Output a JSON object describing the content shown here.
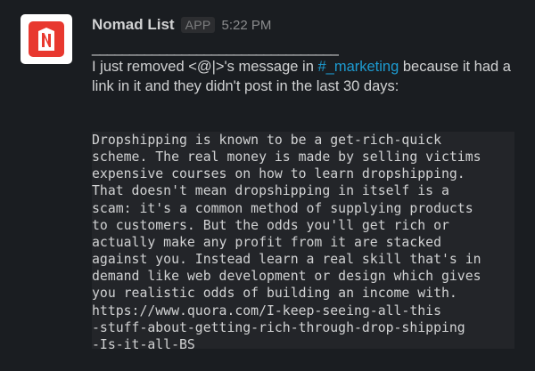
{
  "message": {
    "sender": "Nomad List",
    "badge": "APP",
    "time": "5:22 PM",
    "avatar_icon": "nomad-list-logo",
    "divider": "_________________________________",
    "body_prefix": "I just removed <@|>'s message in ",
    "channel": "#_marketing",
    "body_suffix": " because it had a link in it and they didn't post in the last 30 days:",
    "quoted_message": "Dropshipping is known to be a get-rich-quick\nscheme. The real money is made by selling victims\nexpensive courses on how to learn dropshipping.\nThat doesn't mean dropshipping in itself is a\nscam: it's a common method of supplying products\nto customers. But the odds you'll get rich or\nactually make any profit from it are stacked\nagainst you. Instead learn a real skill that's in\ndemand like web development or design which gives\nyou realistic odds of building an income with.\nhttps://www.quora.com/I-keep-seeing-all-this\n-stuff-about-getting-rich-through-drop-shipping\n-Is-it-all-BS"
  },
  "colors": {
    "background": "#1a1d21",
    "text": "#d1d2d3",
    "link": "#1d9bd1",
    "logo_red": "#e8382f",
    "code_background": "#232529"
  }
}
